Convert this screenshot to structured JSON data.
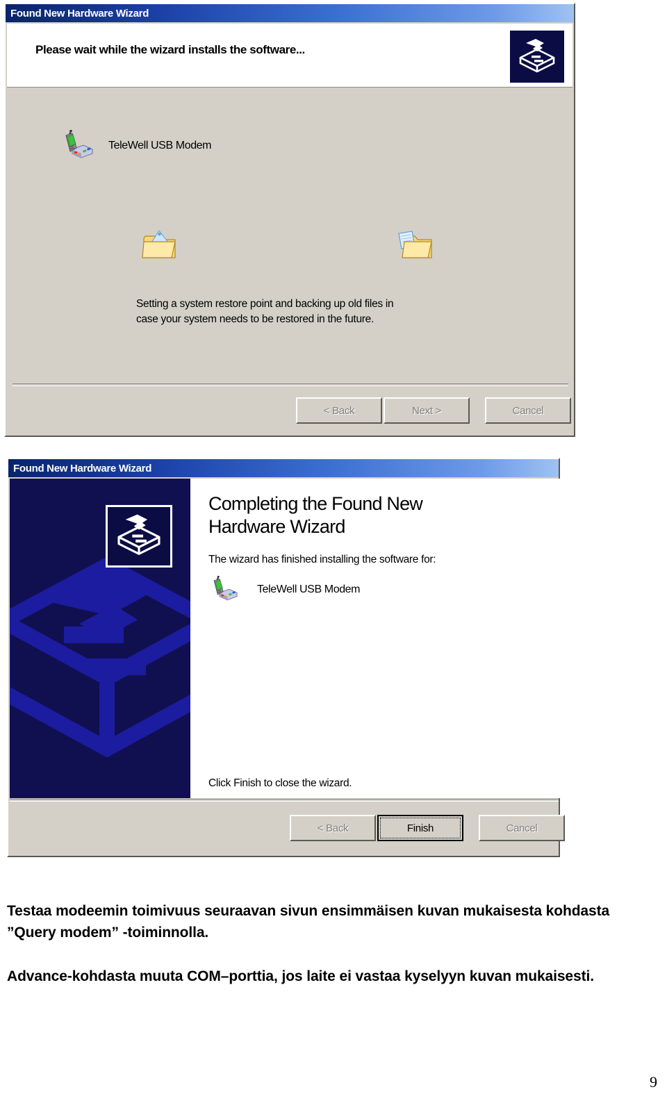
{
  "document": {
    "page_number": "9"
  },
  "dialog_install": {
    "title": "Found New Hardware Wizard",
    "header_text": "Please wait while the wizard installs the software...",
    "badge_icon": "hardware-wizard-icon",
    "device": {
      "icon": "usb-modem-icon",
      "label": "TeleWell USB Modem"
    },
    "progress_icons": [
      {
        "icon": "folder-document-out-icon"
      },
      {
        "icon": "folder-document-in-icon"
      }
    ],
    "status_line_1": "Setting a system restore point and backing up old files in",
    "status_line_2": "case your system needs to be restored in the future.",
    "buttons": {
      "back": "< Back",
      "back_accel": "B",
      "next": "Next >",
      "next_accel": "N",
      "cancel": "Cancel",
      "back_state": "disabled",
      "next_state": "disabled",
      "cancel_state": "disabled"
    }
  },
  "dialog_complete": {
    "title": "Found New Hardware Wizard",
    "banner_icon": "hardware-wizard-icon",
    "banner_watermark_icon": "hardware-wizard-watermark",
    "heading_line_1": "Completing the Found New",
    "heading_line_2": "Hardware Wizard",
    "subtitle": "The wizard has finished installing the software for:",
    "device": {
      "icon": "usb-modem-icon",
      "label": "TeleWell USB Modem"
    },
    "footnote": "Click Finish to close the wizard.",
    "buttons": {
      "back": "< Back",
      "back_accel": "B",
      "finish": "Finish",
      "cancel": "Cancel",
      "back_state": "disabled",
      "finish_state": "default",
      "cancel_state": "disabled"
    }
  },
  "captions": {
    "paragraph_1": "Testaa modeemin toimivuus seuraavan sivun ensimmäisen kuvan mukaisesta kohdasta ”Query modem” -toiminnolla.",
    "paragraph_2": "Advance-kohdasta muuta COM–porttia, jos laite ei vastaa  kyselyyn kuvan mukaisesti."
  },
  "colors": {
    "dialog_face": "#d4d0c8",
    "titlebar_start": "#0a246a",
    "titlebar_end": "#9fc2f2",
    "banner_background": "#101050",
    "banner_watermark": "#1c1ca0",
    "badge_background": "#0c0c44",
    "text": "#000000",
    "disabled_text": "#808080"
  }
}
